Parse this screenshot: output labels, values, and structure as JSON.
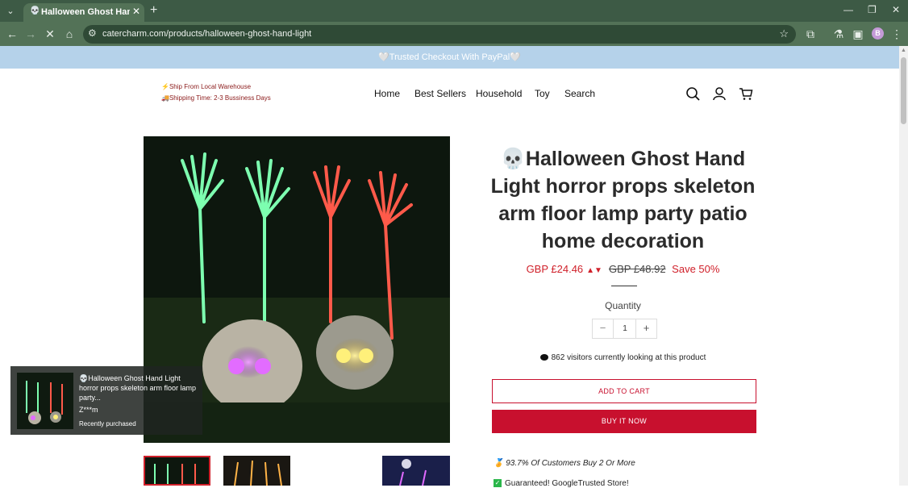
{
  "browser": {
    "tab_title": "Halloween Ghost Hand Light",
    "tab_favicon": "💀",
    "new_tab": "+",
    "url": "catercharm.com/products/halloween-ghost-hand-light",
    "profile_initial": "B"
  },
  "announcement": "🤍Trusted Checkout With PayPal🤍",
  "promo": {
    "line1": "⚡Ship From Local Warehouse",
    "line2": "🚚Shipping Time: 2-3 Bussiness Days"
  },
  "nav": [
    "Home",
    "Best Sellers",
    "Household",
    "Toy",
    "Search"
  ],
  "product": {
    "title": "💀Halloween Ghost Hand Light horror props skeleton arm floor lamp party patio home decoration",
    "price": "GBP £24.46",
    "compare_price": "GBP £48.92",
    "save": "Save 50%",
    "quantity_label": "Quantity",
    "quantity": "1",
    "visitors": "862 visitors currently looking at this product",
    "add_to_cart": "ADD TO CART",
    "buy_now": "BUY IT NOW",
    "feature1": "🏅 93.7% Of Customers Buy 2 Or More",
    "feature2": "Guaranteed! GoogleTrusted Store!"
  },
  "popup": {
    "title": "💀Halloween Ghost Hand Light horror props skeleton arm floor lamp party...",
    "customer": "Z***m",
    "status": "Recently purchased"
  },
  "colors": {
    "tab_bar": "#3d5a45",
    "nav_bar": "#537257",
    "announcement_bg": "#b5d2ea",
    "accent_red": "#c8102e",
    "price_red": "#d0202a"
  }
}
